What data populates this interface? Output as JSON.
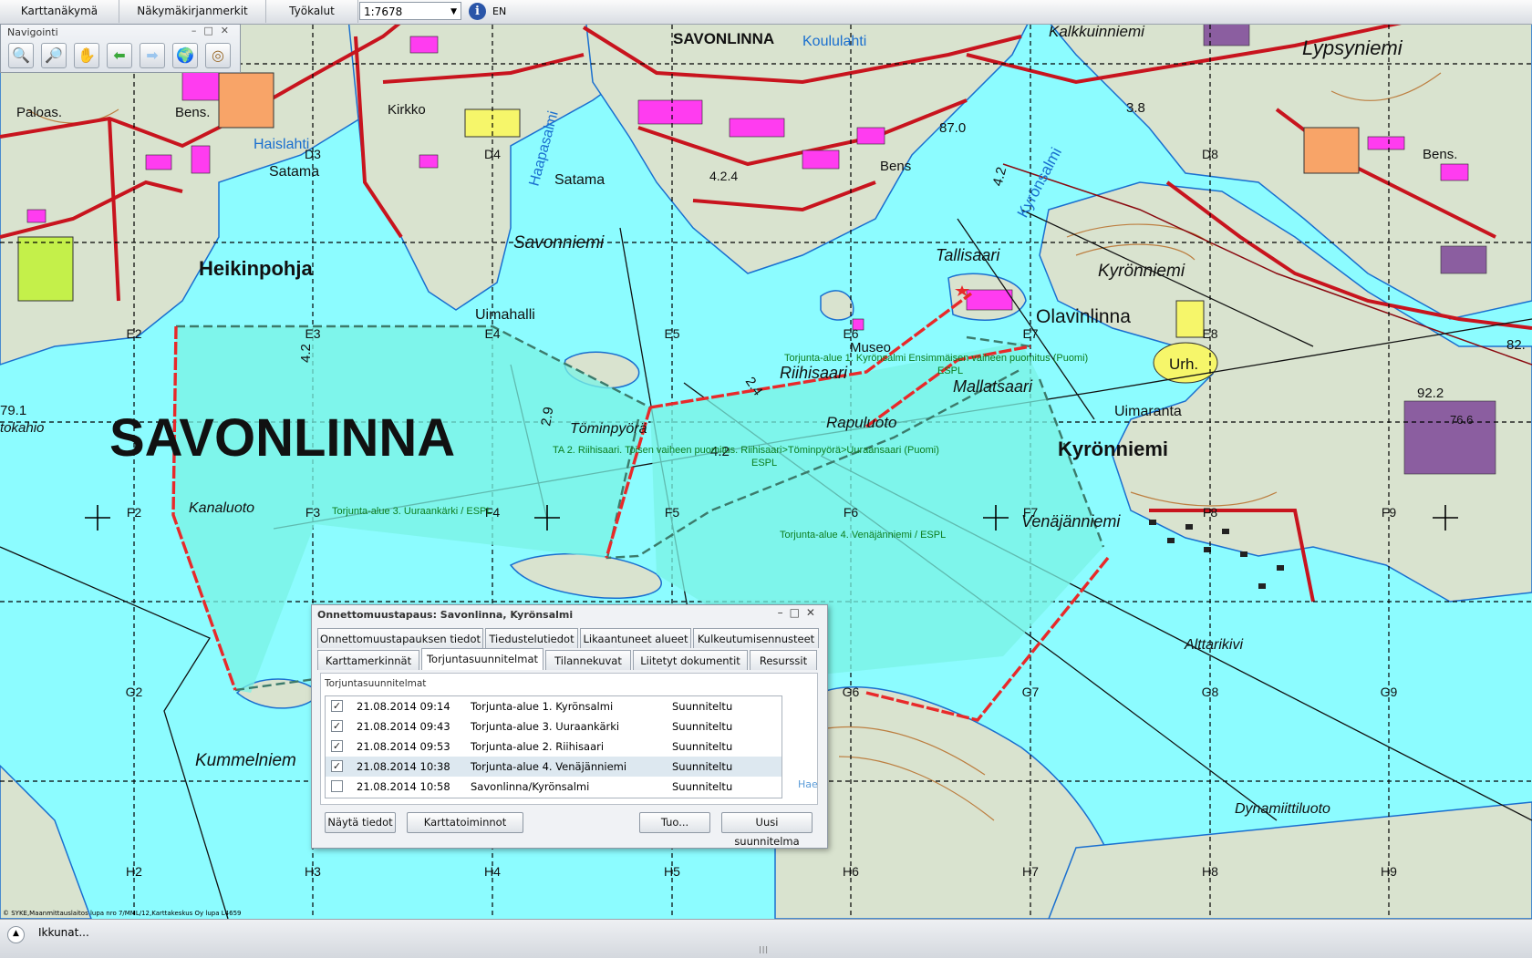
{
  "toolbar": {
    "menu1": "Karttanäkymä",
    "menu2": "Näkymäkirjanmerkit",
    "menu3": "Työkalut",
    "scale_value": "1:7678",
    "lang": "EN"
  },
  "navigation": {
    "title": "Navigointi",
    "buttons": [
      "zoom-in",
      "zoom-out",
      "pan",
      "back",
      "forward",
      "full-extent",
      "center"
    ]
  },
  "map": {
    "place_names": {
      "savonlinna_big": "SAVONLINNA",
      "savonlinna_small": "SAVONLINNA",
      "heikinpohja": "Heikinpohja",
      "kyronniemi1": "Kyrönniemi",
      "kyronniemi2": "Kyrönniemi",
      "olavinlinna": "Olavinlinna",
      "tallisaari": "Tallisaari",
      "riihisaari": "Riihisaari",
      "mallatsaari": "Mallatsaari",
      "raputuoto": "Rapuluoto",
      "tominpyora": "Töminpyörä",
      "kanaluoto": "Kanaluoto",
      "venajanniemi": "Venäjänniemi",
      "alttarikivi": "Alttarikivi",
      "dynamiittiluoto": "Dynamiittiluoto",
      "kummelniemi": "Kummelniem",
      "lypsyniemi": "Lypsyniemi",
      "kalkkuinniemi": "Kalkkuinniemi",
      "haislahti": "Haislahti",
      "koululahti": "Koululahti",
      "haapasalmi": "Haapasalmi",
      "kyronsalmi": "Kyrönsalmi",
      "savonniemi": "Savonniemi",
      "satama1": "Satama",
      "satama2": "Satama",
      "uimahalli": "Uimahalli",
      "uimaranta": "Uimaranta",
      "museo": "Museo",
      "paloas": "Paloas.",
      "kirkko": "Kirkko",
      "urh": "Urh.",
      "bens1": "Bens.",
      "bens2": "Bens",
      "bens3": "Bens.",
      "tokahio": "tokahio"
    },
    "numbers": {
      "n79": "79.1",
      "n92": "92.2",
      "n82": "82.",
      "n76": "76.6",
      "n87": "87.0",
      "n38": "3.8",
      "n42a": "4.2",
      "n42b": "4.2",
      "n29": "2.9",
      "n24": "2.4",
      "n42c": "4.2",
      "n424": "4.2.4"
    },
    "grid_labels": {
      "D3": "D3",
      "D4": "D4",
      "D8": "D8",
      "E2": "E2",
      "E3": "E3",
      "E4": "E4",
      "E5": "E5",
      "E6": "E6",
      "E7": "E7",
      "E8": "E8",
      "F2": "F2",
      "F3": "F3",
      "F4": "F4",
      "F5": "F5",
      "F6": "F6",
      "F7": "F7",
      "F8": "F8",
      "F9": "F9",
      "G2": "G2",
      "G6": "G6",
      "G7": "G7",
      "G8": "G8",
      "G9": "G9",
      "H2": "H2",
      "H3": "H3",
      "H4": "H4",
      "H5": "H5",
      "H6": "H6",
      "H7": "H7",
      "H8": "H8",
      "H9": "H9"
    },
    "area_labels": {
      "area1": "Torjunta-alue 1. Kyrönsalmi Ensimmäisen vaiheen puomitus  (Puomi)",
      "area1_org": "ESPL",
      "area2": "TA 2. Riihisaari. Toisen vaiheen puomitus. Riihisaari>Töminpyörä>Uuraansaari  (Puomi)",
      "area2_org": "ESPL",
      "area3": "Torjunta-alue 3. Uuraankärki /  ESPL",
      "area4": "Torjunta-alue 4. Venäjänniemi /  ESPL"
    },
    "colors": {
      "water": "#8cfcff",
      "land": "#d8e4d0",
      "road": "#c8141e",
      "building": "#ff3cf0",
      "boom_red": "#e8292a",
      "area_fill": "#79f3e4"
    }
  },
  "dialog": {
    "title": "Onnettomuustapaus: Savonlinna, Kyrönsalmi",
    "tabs_row1": [
      "Onnettomuustapauksen tiedot",
      "Tiedustelutiedot",
      "Likaantuneet alueet",
      "Kulkeutumisennusteet"
    ],
    "tabs_row2": [
      "Karttamerkinnät",
      "Torjuntasuunnitelmat",
      "Tilannekuvat",
      "Liitetyt dokumentit",
      "Resurssit"
    ],
    "active_tab": "Torjuntasuunnitelmat",
    "panel_label": "Torjuntasuunnitelmat",
    "plans": [
      {
        "checked": true,
        "date": "21.08.2014 09:14",
        "name": "Torjunta-alue 1. Kyrönsalmi",
        "status": "Suunniteltu"
      },
      {
        "checked": true,
        "date": "21.08.2014 09:43",
        "name": "Torjunta-alue 3. Uuraankärki",
        "status": "Suunniteltu"
      },
      {
        "checked": true,
        "date": "21.08.2014 09:53",
        "name": "Torjunta-alue 2. Riihisaari",
        "status": "Suunniteltu"
      },
      {
        "checked": true,
        "date": "21.08.2014 10:38",
        "name": "Torjunta-alue 4. Venäjänniemi",
        "status": "Suunniteltu"
      },
      {
        "checked": false,
        "date": "21.08.2014 10:58",
        "name": "Savonlinna/Kyrönsalmi",
        "status": "Suunniteltu"
      }
    ],
    "hae": "Hae",
    "buttons": {
      "show_info": "Näytä tiedot",
      "map_functions": "Karttatoiminnot",
      "import": "Tuo...",
      "new_plan": "Uusi suunnitelma"
    }
  },
  "statusbar": {
    "windows": "Ikkunat...",
    "copyright": "© SYKE,Maanmittauslaitos lupa nro 7/MML/12,Karttakeskus Oy lupa L4659"
  }
}
